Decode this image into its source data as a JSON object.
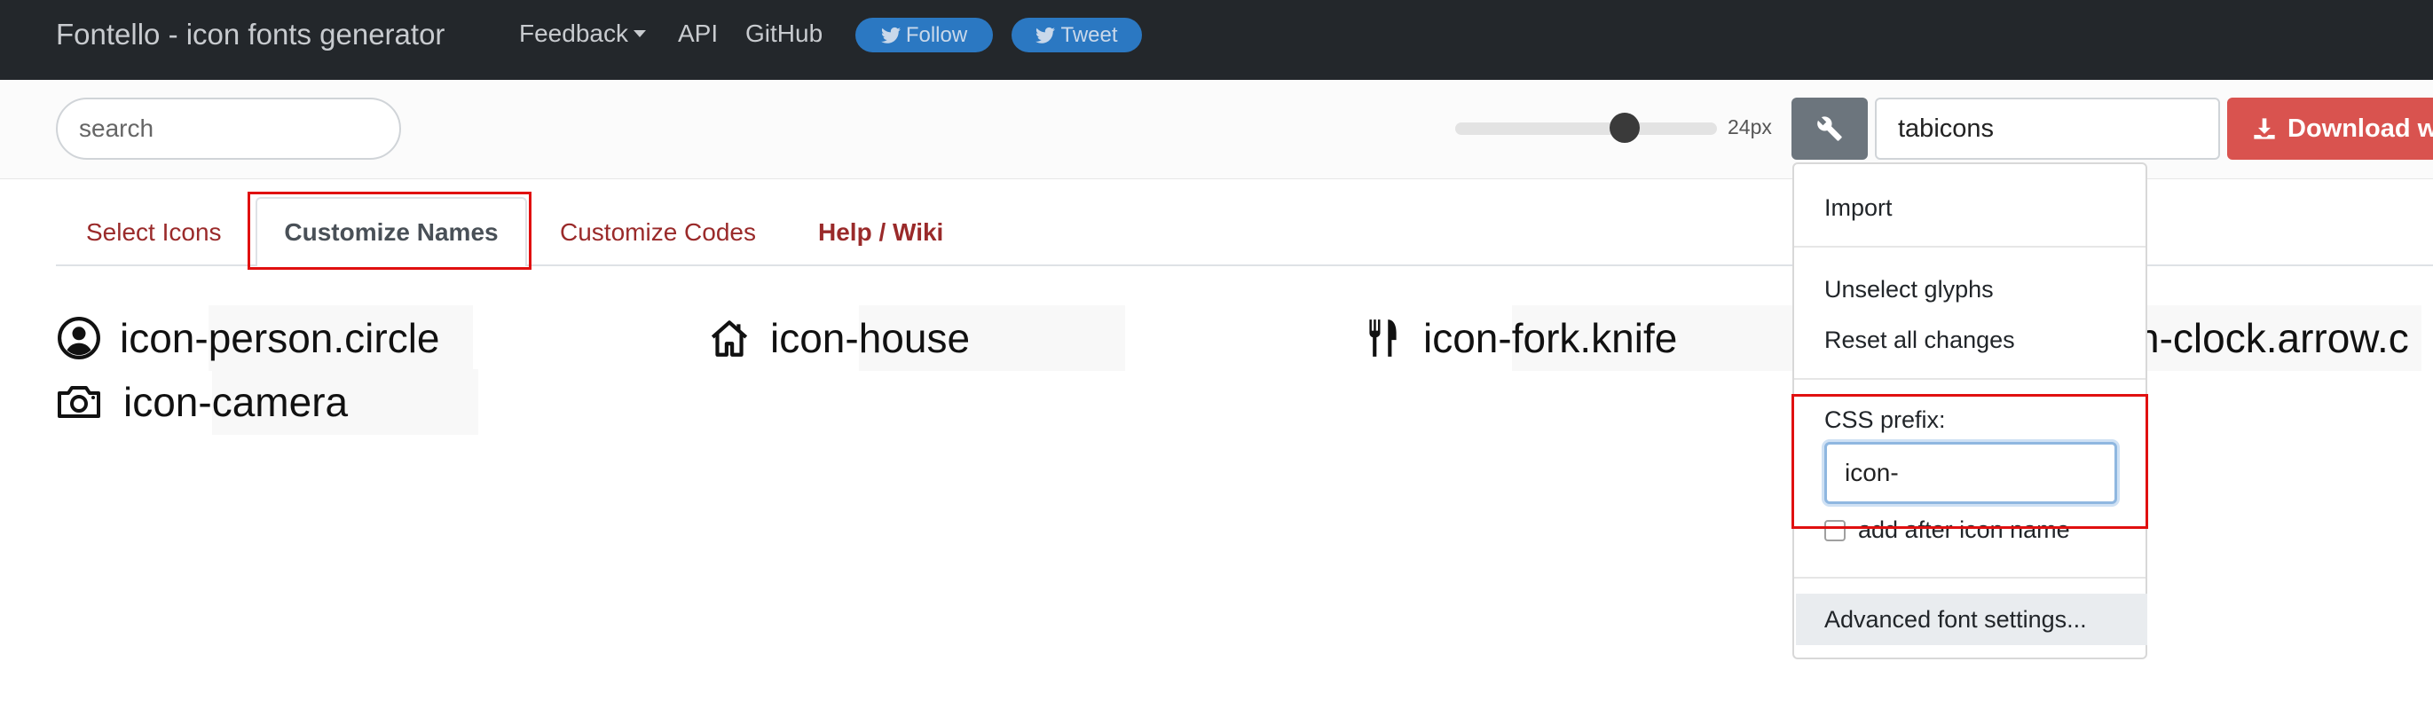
{
  "navbar": {
    "brand": "Fontello - icon fonts generator",
    "links": {
      "feedback": "Feedback",
      "api": "API",
      "github": "GitHub"
    },
    "follow_label": "Follow",
    "tweet_label": "Tweet"
  },
  "toolbar": {
    "search_placeholder": "search",
    "size_value": 24,
    "size_label": "24px",
    "font_name": "tabicons",
    "download_label": "Download w"
  },
  "tabs": {
    "select_icons": "Select Icons",
    "customize_names": "Customize Names",
    "customize_codes": "Customize Codes",
    "help": "Help / Wiki"
  },
  "glyphs": {
    "prefix": "icon-",
    "person_circle": "person.circle",
    "house": "house",
    "fork_knife": "fork.knife",
    "clock_arrow_partial": "n-clock.arrow.c",
    "camera": "camera"
  },
  "dropdown": {
    "import": "Import",
    "unselect": "Unselect glyphs",
    "reset": "Reset all changes",
    "css_prefix_label": "CSS prefix:",
    "css_prefix_value": "icon-",
    "add_after": "add after icon name",
    "advanced": "Advanced font settings..."
  },
  "colors": {
    "navbar_bg": "#23272b",
    "social_btn": "#2b78c2",
    "download_btn": "#d9534f",
    "tab_link": "#9a2a2a",
    "highlight": "#e01010"
  },
  "icons": [
    "twitter-icon",
    "wrench-icon",
    "download-icon",
    "person-circle-icon",
    "house-icon",
    "fork-knife-icon",
    "camera-icon"
  ]
}
